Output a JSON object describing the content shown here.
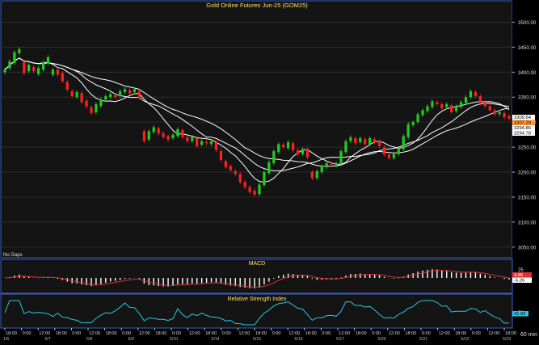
{
  "title": "Gold Online Futures Jun-25 (GOM25)",
  "no_gaps_label": "No Gaps",
  "timeframe": "60 min",
  "price_axis": {
    "ticks": [
      "3500.00",
      "3450.00",
      "3400.00",
      "3350.00",
      "3300.00",
      "3250.00",
      "3200.00",
      "3150.00",
      "3100.00",
      "3050.00"
    ],
    "badges": [
      {
        "text": "3309.64",
        "color": "#ffffff",
        "fg": "#000000"
      },
      {
        "text": "3307.20",
        "color": "#ff9933",
        "fg": "#000000"
      },
      {
        "text": "3294.86",
        "color": "#ffffff",
        "fg": "#000000"
      },
      {
        "text": "3294.78",
        "color": "#ffffff",
        "fg": "#000000"
      }
    ]
  },
  "macd": {
    "title": "MACD",
    "ticks": [
      "25",
      "0"
    ],
    "badges": [
      {
        "text": "4.80",
        "color": "#e03030",
        "fg": "#ffffff"
      },
      {
        "text": "-5.26",
        "color": "#ffffff",
        "fg": "#000000"
      }
    ]
  },
  "rsi": {
    "title": "Relative Strength Index",
    "ticks": [
      "50"
    ],
    "badges": [
      {
        "text": "41.92",
        "color": "#22c8e8",
        "fg": "#000000"
      }
    ]
  },
  "time_axis": {
    "labels": [
      "18:00",
      "0:00",
      "12:00",
      "18:00",
      "0:00",
      "12:00",
      "18:00",
      "0:00",
      "12:00",
      "18:00",
      "0:00",
      "12:00",
      "18:00",
      "0:00",
      "12:00",
      "18:00",
      "0:00",
      "12:00",
      "18:00",
      "0:00",
      "12:00",
      "18:00",
      "0:00",
      "12:00",
      "18:00",
      "0:00",
      "12:00",
      "18:00",
      "0:00",
      "12:00",
      "18:00"
    ],
    "dates": [
      "1/6",
      "5/7",
      "5/8",
      "5/9",
      "5/10",
      "5/14",
      "5/15",
      "5/16",
      "5/17",
      "5/20",
      "5/21",
      "5/22",
      "5/23"
    ]
  },
  "colors": {
    "up": "#22cc22",
    "down": "#ff2020",
    "ma": "#ffffff",
    "rsi": "#22c8e8",
    "macd_signal": "#e03030",
    "panel_border": "#3a62c8",
    "title_text": "#ffe060"
  },
  "chart_data": {
    "type": "candlestick",
    "title": "Gold Online Futures Jun-25 (GOM25)",
    "ylim": [
      3040,
      3525
    ],
    "ohlc_path": [
      [
        3400,
        3405
      ],
      [
        3408,
        3422
      ],
      [
        3418,
        3440
      ],
      [
        3438,
        3446
      ],
      [
        3420,
        3398
      ],
      [
        3402,
        3415
      ],
      [
        3410,
        3402
      ],
      [
        3396,
        3408
      ],
      [
        3405,
        3420
      ],
      [
        3418,
        3430
      ],
      [
        3395,
        3405
      ],
      [
        3405,
        3395
      ],
      [
        3398,
        3382
      ],
      [
        3380,
        3365
      ],
      [
        3362,
        3352
      ],
      [
        3350,
        3360
      ],
      [
        3358,
        3340
      ],
      [
        3343,
        3331
      ],
      [
        3330,
        3318
      ],
      [
        3320,
        3336
      ],
      [
        3332,
        3346
      ],
      [
        3345,
        3352
      ],
      [
        3350,
        3356
      ],
      [
        3354,
        3350
      ],
      [
        3352,
        3362
      ],
      [
        3360,
        3366
      ],
      [
        3364,
        3358
      ],
      [
        3360,
        3366
      ],
      [
        3362,
        3348
      ],
      [
        3282,
        3262
      ],
      [
        3265,
        3282
      ],
      [
        3280,
        3290
      ],
      [
        3288,
        3277
      ],
      [
        3278,
        3270
      ],
      [
        3272,
        3265
      ],
      [
        3268,
        3275
      ],
      [
        3272,
        3286
      ],
      [
        3284,
        3270
      ],
      [
        3270,
        3262
      ],
      [
        3262,
        3270
      ],
      [
        3268,
        3252
      ],
      [
        3255,
        3262
      ],
      [
        3260,
        3258
      ],
      [
        3256,
        3262
      ],
      [
        3260,
        3244
      ],
      [
        3242,
        3224
      ],
      [
        3222,
        3210
      ],
      [
        3212,
        3204
      ],
      [
        3202,
        3196
      ],
      [
        3196,
        3180
      ],
      [
        3180,
        3170
      ],
      [
        3170,
        3160
      ],
      [
        3163,
        3155
      ],
      [
        3156,
        3175
      ],
      [
        3174,
        3200
      ],
      [
        3198,
        3220
      ],
      [
        3218,
        3242
      ],
      [
        3240,
        3256
      ],
      [
        3255,
        3250
      ],
      [
        3248,
        3260
      ],
      [
        3258,
        3244
      ],
      [
        3244,
        3236
      ],
      [
        3236,
        3246
      ],
      [
        3246,
        3230
      ],
      [
        3200,
        3188
      ],
      [
        3188,
        3202
      ],
      [
        3200,
        3212
      ],
      [
        3210,
        3218
      ],
      [
        3216,
        3214
      ],
      [
        3214,
        3218
      ],
      [
        3216,
        3242
      ],
      [
        3240,
        3262
      ],
      [
        3262,
        3270
      ],
      [
        3268,
        3258
      ],
      [
        3260,
        3268
      ],
      [
        3266,
        3256
      ],
      [
        3256,
        3268
      ],
      [
        3266,
        3260
      ],
      [
        3262,
        3252
      ],
      [
        3250,
        3235
      ],
      [
        3235,
        3228
      ],
      [
        3228,
        3236
      ],
      [
        3236,
        3246
      ],
      [
        3246,
        3272
      ],
      [
        3270,
        3296
      ],
      [
        3294,
        3300
      ],
      [
        3300,
        3316
      ],
      [
        3314,
        3324
      ],
      [
        3322,
        3332
      ],
      [
        3330,
        3342
      ],
      [
        3340,
        3336
      ],
      [
        3336,
        3328
      ],
      [
        3330,
        3336
      ],
      [
        3334,
        3320
      ],
      [
        3322,
        3332
      ],
      [
        3330,
        3340
      ],
      [
        3338,
        3350
      ],
      [
        3350,
        3362
      ],
      [
        3360,
        3352
      ],
      [
        3352,
        3338
      ],
      [
        3340,
        3332
      ],
      [
        3332,
        3324
      ],
      [
        3324,
        3316
      ],
      [
        3316,
        3320
      ],
      [
        3318,
        3310
      ],
      [
        3312,
        3307
      ]
    ]
  }
}
